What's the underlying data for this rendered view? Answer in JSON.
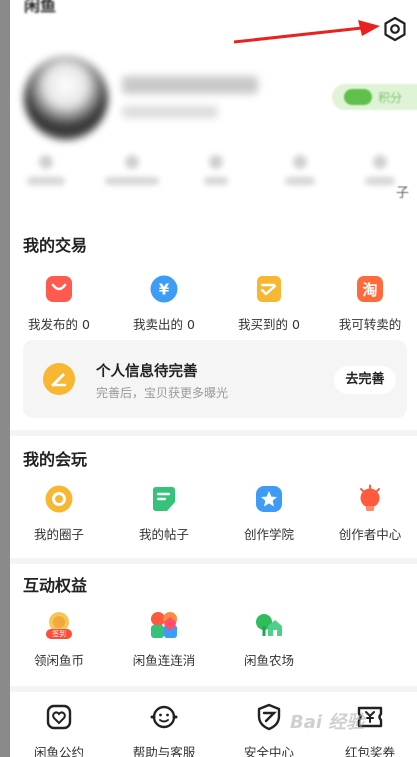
{
  "header": {
    "title": "闲鱼",
    "points_label": "积分",
    "stats_last_label": "子"
  },
  "trade": {
    "title": "我的交易",
    "items": [
      {
        "label": "我发布的 0",
        "icon": "bag-icon",
        "color": "#ff5a4f"
      },
      {
        "label": "我卖出的 0",
        "icon": "yen-icon",
        "color": "#3e9cf6"
      },
      {
        "label": "我买到的 0",
        "icon": "order-check-icon",
        "color": "#f7b733"
      },
      {
        "label": "我可转卖的",
        "icon": "resell-icon",
        "color": "#ff6a3d"
      }
    ]
  },
  "profile_card": {
    "title": "个人信息待完善",
    "subtitle": "完善后，宝贝获更多曝光",
    "button": "去完善"
  },
  "play": {
    "title": "我的会玩",
    "items": [
      {
        "label": "我的圈子",
        "icon": "circle-icon",
        "color": "#f7b733"
      },
      {
        "label": "我的帖子",
        "icon": "post-icon",
        "color": "#35c27a"
      },
      {
        "label": "创作学院",
        "icon": "star-badge-icon",
        "color": "#3e9cf6"
      },
      {
        "label": "创作者中心",
        "icon": "bulb-icon",
        "color": "#ff5a3c"
      }
    ]
  },
  "rights": {
    "title": "互动权益",
    "items": [
      {
        "label": "领闲鱼币",
        "icon": "coin-sign-icon",
        "badge": "签到"
      },
      {
        "label": "闲鱼连连消",
        "icon": "match-game-icon"
      },
      {
        "label": "闲鱼农场",
        "icon": "farm-icon"
      }
    ]
  },
  "services": {
    "items": [
      {
        "label": "闲鱼公约",
        "icon": "shield-heart-icon"
      },
      {
        "label": "帮助与客服",
        "icon": "service-icon"
      },
      {
        "label": "安全中心",
        "icon": "security-icon"
      },
      {
        "label": "红包奖券",
        "icon": "ticket-icon"
      }
    ]
  },
  "watermark": "Bai 经验"
}
